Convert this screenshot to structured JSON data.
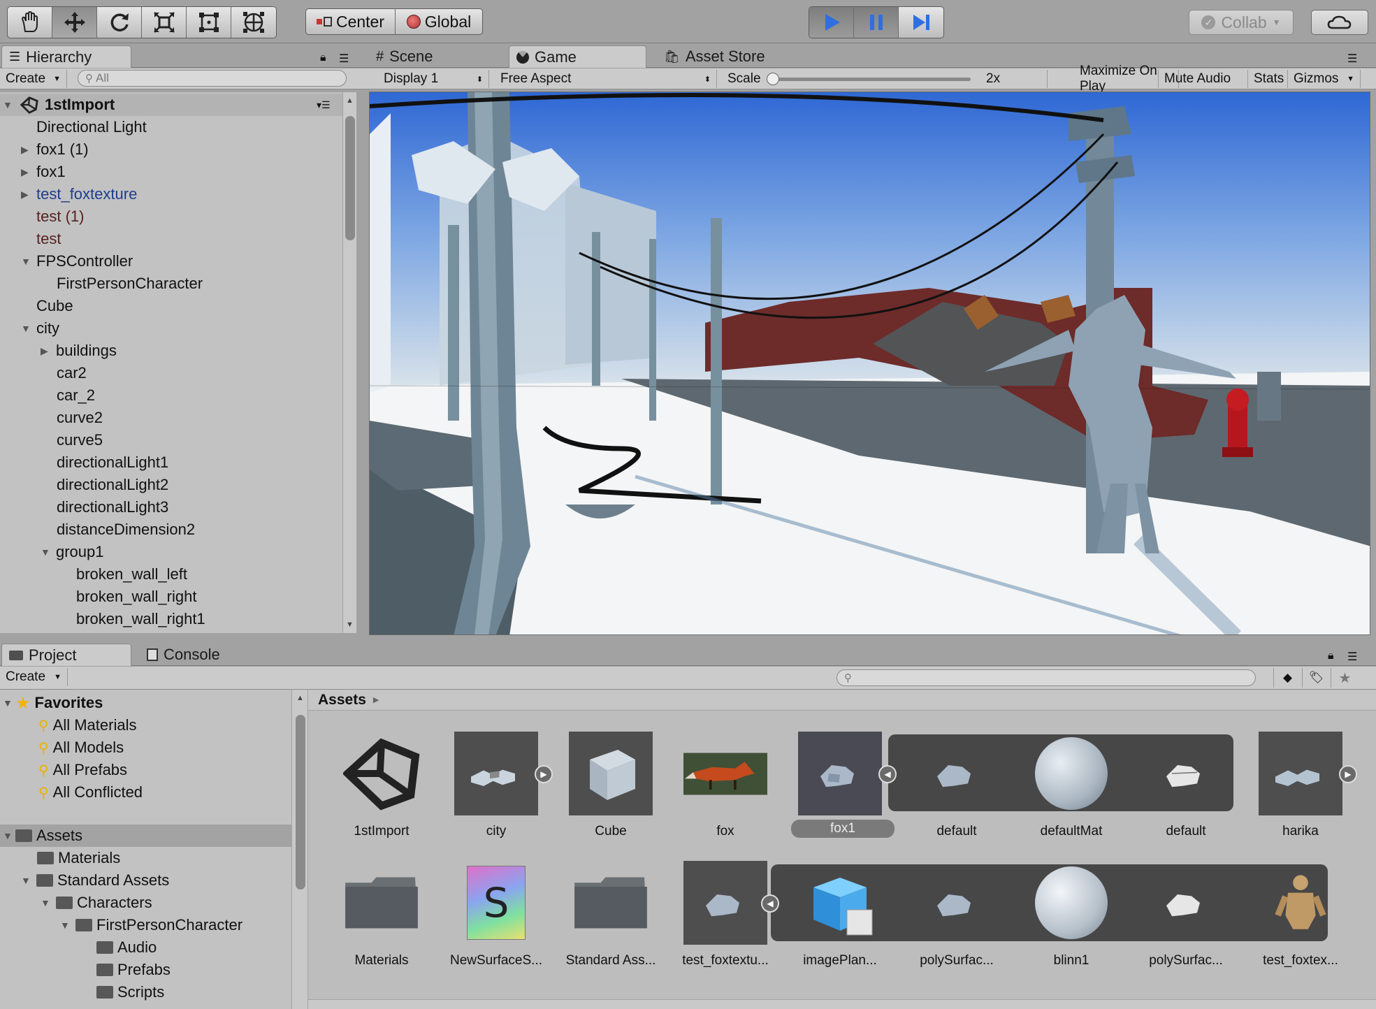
{
  "toolbar": {
    "tools": [
      "hand-icon",
      "move-icon",
      "rotate-icon",
      "scale-icon",
      "rect-icon",
      "transform-icon"
    ],
    "pivot_center": "Center",
    "pivot_global": "Global",
    "collab": "Collab"
  },
  "hierarchy": {
    "tab": "Hierarchy",
    "create": "Create",
    "search_placeholder": "All",
    "scene_name": "1stImport",
    "items": [
      {
        "label": "Directional Light"
      },
      {
        "label": "fox1 (1)"
      },
      {
        "label": "fox1"
      },
      {
        "label": "test_foxtexture"
      },
      {
        "label": "test (1)"
      },
      {
        "label": "test"
      },
      {
        "label": "FPSController"
      },
      {
        "label": "FirstPersonCharacter"
      },
      {
        "label": "Cube"
      },
      {
        "label": "city"
      },
      {
        "label": "buildings"
      },
      {
        "label": "car2"
      },
      {
        "label": "car_2"
      },
      {
        "label": "curve2"
      },
      {
        "label": "curve5"
      },
      {
        "label": "directionalLight1"
      },
      {
        "label": "directionalLight2"
      },
      {
        "label": "directionalLight3"
      },
      {
        "label": "distanceDimension2"
      },
      {
        "label": "group1"
      },
      {
        "label": "broken_wall_left"
      },
      {
        "label": "broken_wall_right"
      },
      {
        "label": "broken_wall_right1"
      }
    ]
  },
  "view_tabs": {
    "scene": "Scene",
    "game": "Game",
    "asset_store": "Asset Store"
  },
  "game_bar": {
    "display": "Display 1",
    "aspect": "Free Aspect",
    "scale_label": "Scale",
    "scale_value": "2x",
    "maximize": "Maximize On Play",
    "mute": "Mute Audio",
    "stats": "Stats",
    "gizmos": "Gizmos"
  },
  "project": {
    "tab": "Project",
    "console_tab": "Console",
    "create": "Create",
    "breadcrumb": "Assets",
    "favorites": {
      "label": "Favorites",
      "items": [
        "All Materials",
        "All Models",
        "All Prefabs",
        "All Conflicted"
      ]
    },
    "tree": [
      {
        "label": "Assets"
      },
      {
        "label": "Materials"
      },
      {
        "label": "Standard Assets"
      },
      {
        "label": "Characters"
      },
      {
        "label": "FirstPersonCharacter"
      },
      {
        "label": "Audio"
      },
      {
        "label": "Prefabs"
      },
      {
        "label": "Scripts"
      }
    ],
    "assets_row1": [
      "1stImport",
      "city",
      "Cube",
      "fox",
      "fox1",
      "default",
      "defaultMat",
      "default",
      "harika"
    ],
    "assets_row2": [
      "Materials",
      "NewSurfaceS...",
      "Standard Ass...",
      "test_foxtextu...",
      "imagePlan...",
      "polySurfac...",
      "blinn1",
      "polySurfac...",
      "test_foxtex..."
    ]
  },
  "colors": {
    "prefab_link": "#1e3d8c",
    "missing_prefab": "#5a1f1f",
    "play_blue": "#2f6fe0"
  }
}
